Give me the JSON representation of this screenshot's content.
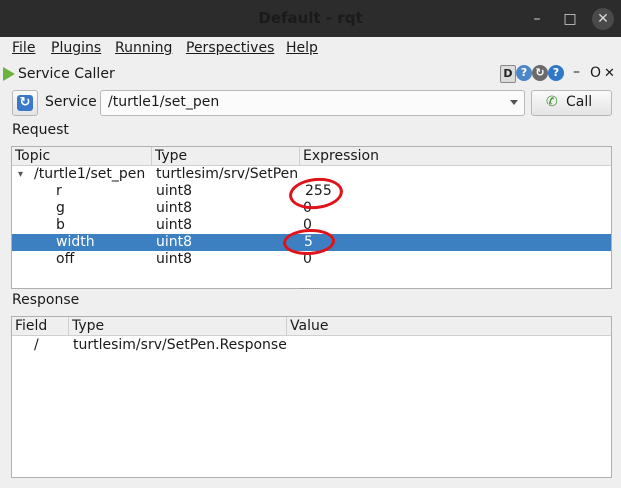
{
  "window": {
    "title": "Default - rqt"
  },
  "menu": [
    {
      "label": "File"
    },
    {
      "label": "Plugins"
    },
    {
      "label": "Running"
    },
    {
      "label": "Perspectives"
    },
    {
      "label": "Help"
    }
  ],
  "plugin": {
    "title": "Service Caller",
    "header_controls": [
      "D",
      "close-x",
      "O"
    ]
  },
  "service": {
    "label": "Service",
    "value": "/turtle1/set_pen",
    "call_label": "Call"
  },
  "request": {
    "section_label": "Request",
    "columns": [
      "Topic",
      "Type",
      "Expression"
    ],
    "rows": [
      {
        "topic": "/turtle1/set_pen",
        "type": "turtlesim/srv/SetPen",
        "expression": ""
      },
      {
        "topic": "r",
        "type": "uint8",
        "expression": "255"
      },
      {
        "topic": "g",
        "type": "uint8",
        "expression": "0"
      },
      {
        "topic": "b",
        "type": "uint8",
        "expression": "0"
      },
      {
        "topic": "width",
        "type": "uint8",
        "expression": "5"
      },
      {
        "topic": "off",
        "type": "uint8",
        "expression": "0"
      }
    ]
  },
  "response": {
    "section_label": "Response",
    "columns": [
      "Field",
      "Type",
      "Value"
    ],
    "rows": [
      {
        "field": "/",
        "type": "turtlesim/srv/SetPen.Response",
        "value": ""
      }
    ]
  },
  "colors": {
    "selection": "#3d80c2",
    "annotation": "#e0121a",
    "titlebar": "#2c2c2c"
  }
}
